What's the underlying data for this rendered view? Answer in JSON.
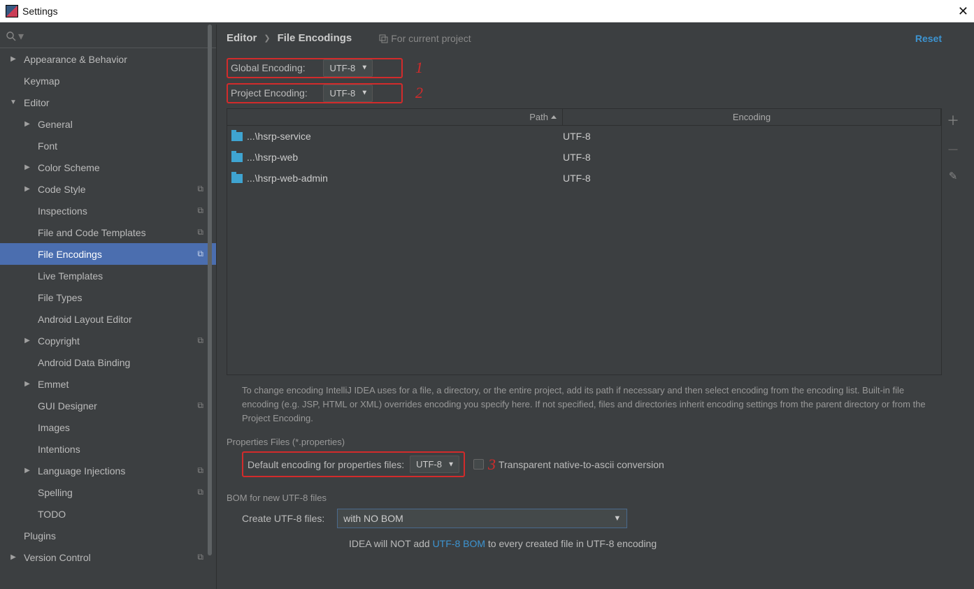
{
  "titlebar": {
    "title": "Settings"
  },
  "sidebar": {
    "items": [
      {
        "label": "Appearance & Behavior",
        "level": 0,
        "arrow": "▶",
        "badge": false
      },
      {
        "label": "Keymap",
        "level": 0,
        "arrow": "",
        "badge": false
      },
      {
        "label": "Editor",
        "level": 0,
        "arrow": "▼",
        "badge": false
      },
      {
        "label": "General",
        "level": 1,
        "arrow": "▶",
        "badge": false
      },
      {
        "label": "Font",
        "level": 1,
        "arrow": "",
        "badge": false
      },
      {
        "label": "Color Scheme",
        "level": 1,
        "arrow": "▶",
        "badge": false
      },
      {
        "label": "Code Style",
        "level": 1,
        "arrow": "▶",
        "badge": true
      },
      {
        "label": "Inspections",
        "level": 1,
        "arrow": "",
        "badge": true
      },
      {
        "label": "File and Code Templates",
        "level": 1,
        "arrow": "",
        "badge": true
      },
      {
        "label": "File Encodings",
        "level": 1,
        "arrow": "",
        "badge": true,
        "selected": true
      },
      {
        "label": "Live Templates",
        "level": 1,
        "arrow": "",
        "badge": false
      },
      {
        "label": "File Types",
        "level": 1,
        "arrow": "",
        "badge": false
      },
      {
        "label": "Android Layout Editor",
        "level": 1,
        "arrow": "",
        "badge": false
      },
      {
        "label": "Copyright",
        "level": 1,
        "arrow": "▶",
        "badge": true
      },
      {
        "label": "Android Data Binding",
        "level": 1,
        "arrow": "",
        "badge": false
      },
      {
        "label": "Emmet",
        "level": 1,
        "arrow": "▶",
        "badge": false
      },
      {
        "label": "GUI Designer",
        "level": 1,
        "arrow": "",
        "badge": true
      },
      {
        "label": "Images",
        "level": 1,
        "arrow": "",
        "badge": false
      },
      {
        "label": "Intentions",
        "level": 1,
        "arrow": "",
        "badge": false
      },
      {
        "label": "Language Injections",
        "level": 1,
        "arrow": "▶",
        "badge": true
      },
      {
        "label": "Spelling",
        "level": 1,
        "arrow": "",
        "badge": true
      },
      {
        "label": "TODO",
        "level": 1,
        "arrow": "",
        "badge": false
      },
      {
        "label": "Plugins",
        "level": 0,
        "arrow": "",
        "badge": false
      },
      {
        "label": "Version Control",
        "level": 0,
        "arrow": "▶",
        "badge": true
      }
    ]
  },
  "breadcrumb": {
    "a": "Editor",
    "b": "File Encodings"
  },
  "projHint": "For current project",
  "reset": "Reset",
  "global": {
    "label": "Global Encoding:",
    "value": "UTF-8",
    "annot": "1"
  },
  "project": {
    "label": "Project Encoding:",
    "value": "UTF-8",
    "annot": "2"
  },
  "table": {
    "head_path": "Path",
    "head_enc": "Encoding",
    "rows": [
      {
        "path": "...\\hsrp-service",
        "enc": "UTF-8"
      },
      {
        "path": "...\\hsrp-web",
        "enc": "UTF-8"
      },
      {
        "path": "...\\hsrp-web-admin",
        "enc": "UTF-8"
      }
    ]
  },
  "help": "To change encoding IntelliJ IDEA uses for a file, a directory, or the entire project, add its path if necessary and then select encoding from the encoding list. Built-in file encoding (e.g. JSP, HTML or XML) overrides encoding you specify here. If not specified, files and directories inherit encoding settings from the parent directory or from the Project Encoding.",
  "props": {
    "section": "Properties Files (*.properties)",
    "label": "Default encoding for properties files:",
    "value": "UTF-8",
    "annot": "3",
    "cb_label": "Transparent native-to-ascii conversion"
  },
  "bom": {
    "section": "BOM for new UTF-8 files",
    "label": "Create UTF-8 files:",
    "value": "with NO BOM",
    "info_a": "IDEA will NOT add ",
    "link": "UTF-8 BOM",
    "info_b": " to every created file in UTF-8 encoding"
  }
}
